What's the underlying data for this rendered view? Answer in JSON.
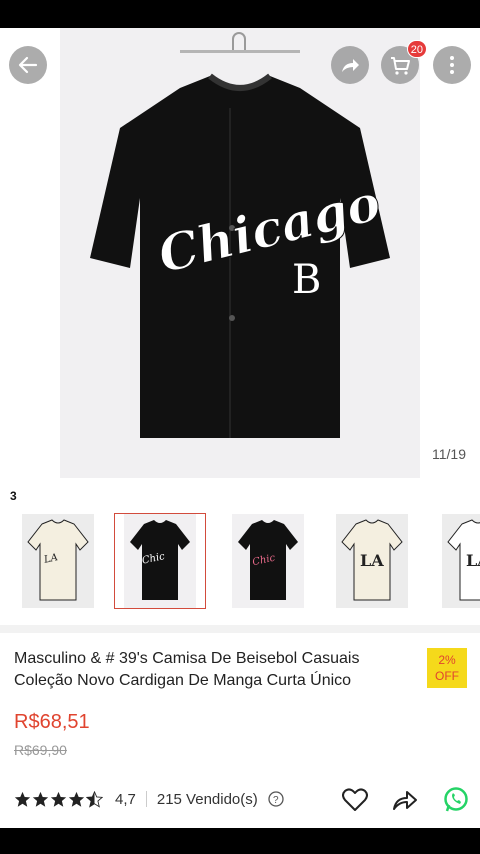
{
  "gallery": {
    "counter": "11/19",
    "cart_count": "20",
    "shirt_text": "Chicago",
    "shirt_logo": "B"
  },
  "thumbnails": {
    "label": "3",
    "items": [
      {
        "icon": "cream-jersey-thumb",
        "selected": false
      },
      {
        "icon": "black-jersey-thumb",
        "selected": true
      },
      {
        "icon": "black-pink-jersey-thumb",
        "selected": false
      },
      {
        "icon": "cream-la-jersey-thumb",
        "selected": false
      },
      {
        "icon": "white-la-jersey-thumb",
        "selected": false
      }
    ]
  },
  "product": {
    "title": "Masculino & # 39's Camisa De Beisebol Casuais Coleção Novo Cardigan De Manga Curta Único",
    "discount_percent": "2%",
    "discount_label": "OFF",
    "price": "R$68,51",
    "old_price": "R$69,90",
    "rating": "4,7",
    "sold": "215 Vendido(s)",
    "stars": 4.5
  },
  "colors": {
    "accent": "#e0442f",
    "badge": "#f5d91b",
    "whatsapp": "#25d366"
  }
}
